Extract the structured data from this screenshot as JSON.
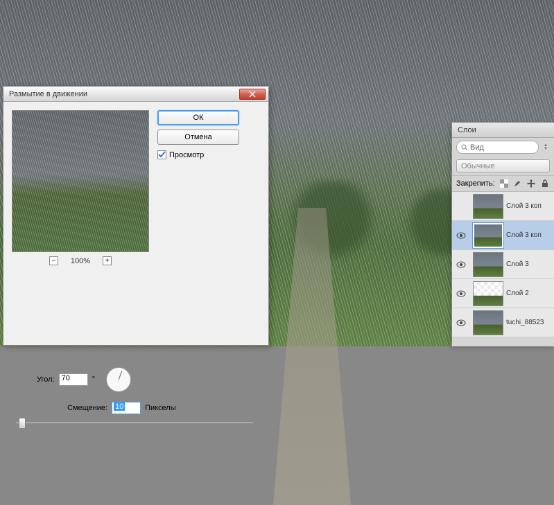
{
  "dialog": {
    "title": "Размытие в движении",
    "ok": "ОК",
    "cancel": "Отмена",
    "preview_checkbox": "Просмотр",
    "zoom": "100%",
    "angle_label": "Угол:",
    "angle_value": "70",
    "angle_unit": "°",
    "offset_label": "Смещение:",
    "offset_value": "10",
    "offset_unit": "Пикселы"
  },
  "layers": {
    "tab": "Слои",
    "search": "Вид",
    "blend_mode": "Обычные",
    "lock_label": "Закрепить:",
    "items": [
      {
        "name": "Слой 3 коп",
        "visible": false,
        "selected": false,
        "thumb": "sky"
      },
      {
        "name": "Слой 3 коп",
        "visible": true,
        "selected": true,
        "thumb": "sky"
      },
      {
        "name": "Слой 3",
        "visible": true,
        "selected": false,
        "thumb": "sky"
      },
      {
        "name": "Слой 2",
        "visible": true,
        "selected": false,
        "thumb": "partial"
      },
      {
        "name": "tuchi_88523",
        "visible": true,
        "selected": false,
        "thumb": "sky"
      }
    ]
  }
}
